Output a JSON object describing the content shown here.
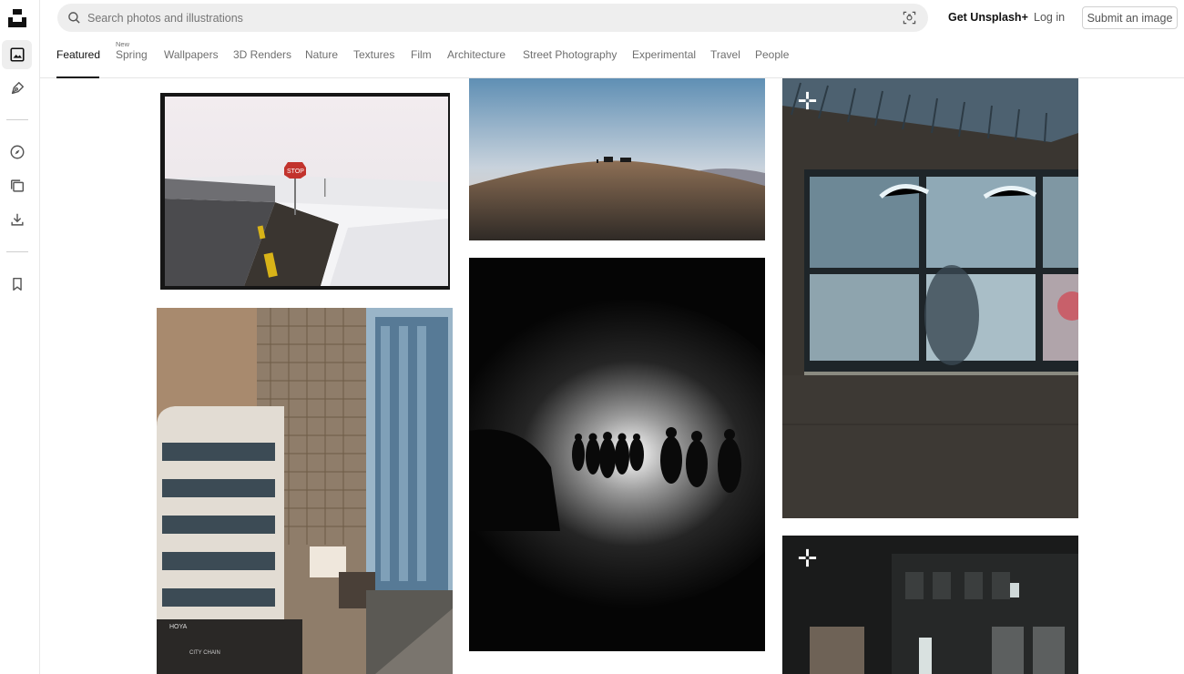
{
  "search": {
    "placeholder": "Search photos and illustrations",
    "icon": "search-icon",
    "visual_search_icon": "visual-search-icon"
  },
  "header": {
    "get_plus": "Get Unsplash+",
    "login": "Log in",
    "submit": "Submit an image"
  },
  "tabs": {
    "featured": "Featured",
    "spring_badge": "New",
    "spring": "Spring",
    "wallpapers": "Wallpapers",
    "renders": "3D Renders",
    "nature": "Nature",
    "textures": "Textures",
    "film": "Film",
    "architecture": "Architecture",
    "street": "Street Photography",
    "experimental": "Experimental",
    "travel": "Travel",
    "people": "People"
  },
  "photos": [
    {
      "description": "Snowy road with stop sign (film border)"
    },
    {
      "description": "Hilltop at dusk with vehicles"
    },
    {
      "description": "Office window at night"
    },
    {
      "description": "City buildings with scaffolding"
    },
    {
      "description": "Silhouetted group in fog lights"
    },
    {
      "description": "Night street building"
    }
  ],
  "colors": {
    "accent": "#111111",
    "search_bg": "#eeeeee",
    "tab_inactive": "#6f6f6f"
  }
}
